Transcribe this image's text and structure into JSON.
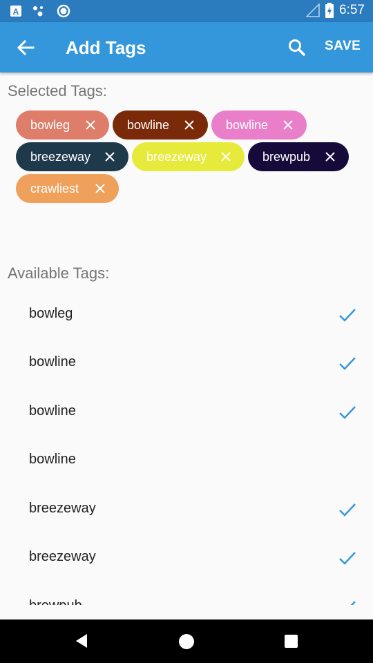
{
  "status_bar": {
    "time": "6:57",
    "icons": [
      "a-icon",
      "assistant-dots-icon",
      "circle-icon",
      "signal-icon",
      "battery-icon"
    ]
  },
  "app_bar": {
    "title": "Add Tags",
    "save_label": "SAVE",
    "background": "#3497db",
    "status_background": "#2b7bbf"
  },
  "selected": {
    "label": "Selected Tags:",
    "chips": [
      {
        "label": "bowleg",
        "color": "#dd7d6a",
        "text_color": "#ffffff"
      },
      {
        "label": "bowline",
        "color": "#7a2a08",
        "text_color": "#ffffff"
      },
      {
        "label": "bowline",
        "color": "#ea7fc9",
        "text_color": "#ffffff"
      },
      {
        "label": "breezeway",
        "color": "#1e3a4a",
        "text_color": "#ffffff"
      },
      {
        "label": "breezeway",
        "color": "#e6ea3a",
        "text_color": "#ffffff"
      },
      {
        "label": "brewpub",
        "color": "#150a3a",
        "text_color": "#ffffff"
      },
      {
        "label": "crawliest",
        "color": "#efa05a",
        "text_color": "#ffffff"
      }
    ]
  },
  "available": {
    "label": "Available Tags:",
    "check_color": "#3497db",
    "items": [
      {
        "label": "bowleg",
        "checked": true
      },
      {
        "label": "bowline",
        "checked": true
      },
      {
        "label": "bowline",
        "checked": true
      },
      {
        "label": "bowline",
        "checked": false
      },
      {
        "label": "breezeway",
        "checked": true
      },
      {
        "label": "breezeway",
        "checked": true
      },
      {
        "label": "brewpub",
        "checked": true
      }
    ]
  }
}
